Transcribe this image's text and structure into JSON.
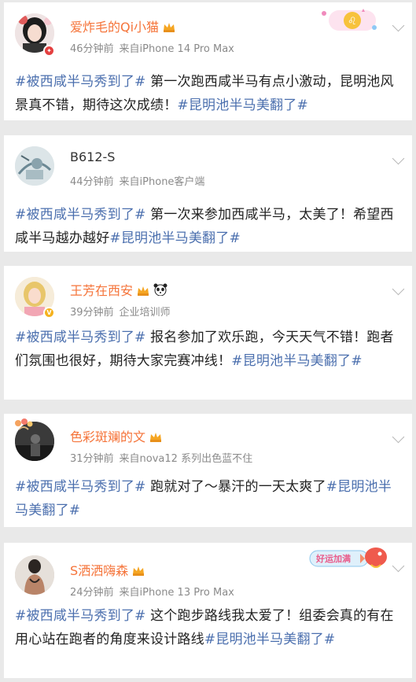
{
  "posts": [
    {
      "username": "爱炸毛的Qi小猫",
      "time": "46分钟前",
      "source": "来自iPhone 14 Pro Max",
      "hashtag_lead": "#被西咸半马秀到了#",
      "body": " 第一次跑西咸半马有点小激动，昆明池风景真不错，期待这次成绩！",
      "hashtag_tail": "#昆明池半马美翻了#",
      "name_color": "#333333"
    },
    {
      "username": "B612-S",
      "time": "44分钟前",
      "source": "来自iPhone客户端",
      "hashtag_lead": "#被西咸半马秀到了#",
      "body": " 第一次来参加西咸半马，太美了！希望西咸半马越办越好",
      "hashtag_tail": "#昆明池半马美翻了#",
      "name_color": "#333333"
    },
    {
      "username": "王芳在西安",
      "time": "39分钟前",
      "source": "企业培训师",
      "hashtag_lead": "#被西咸半马秀到了#",
      "body": " 报名参加了欢乐跑，今天天气不错！跑者们氛围也很好，期待大家完赛冲线！",
      "hashtag_tail": "#昆明池半马美翻了#",
      "name_color": "#f5743a"
    },
    {
      "username": "色彩斑斓的文",
      "time": "31分钟前",
      "source": "来自nova12 系列出色蓝不住",
      "hashtag_lead": "#被西咸半马秀到了#",
      "body": " 跑就对了～暴汗的一天太爽了",
      "hashtag_tail": "#昆明池半马美翻了#",
      "name_color": "#f5743a"
    },
    {
      "username": "S洒洒嗨森",
      "time": "24分钟前",
      "source": "来自iPhone 13 Pro Max",
      "hashtag_lead": "#被西咸半马秀到了#",
      "body": " 这个跑步路线我太爱了！组委会真的有在用心站在跑者的角度来设计路线",
      "hashtag_tail": "#昆明池半马美翻了#",
      "name_color": "#f5743a"
    }
  ],
  "decor": {
    "badge_text": "好运加满"
  }
}
